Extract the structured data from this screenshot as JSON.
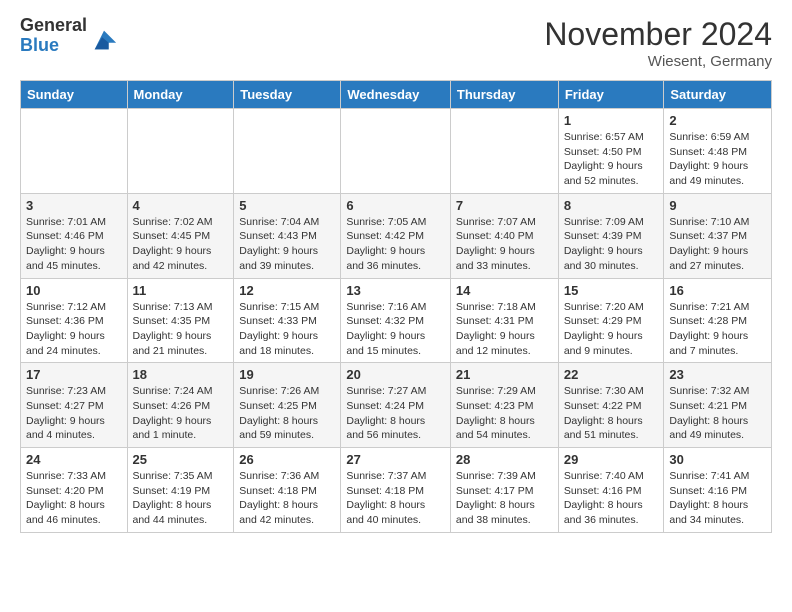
{
  "logo": {
    "general": "General",
    "blue": "Blue"
  },
  "title": "November 2024",
  "location": "Wiesent, Germany",
  "days_of_week": [
    "Sunday",
    "Monday",
    "Tuesday",
    "Wednesday",
    "Thursday",
    "Friday",
    "Saturday"
  ],
  "weeks": [
    [
      {
        "day": "",
        "info": ""
      },
      {
        "day": "",
        "info": ""
      },
      {
        "day": "",
        "info": ""
      },
      {
        "day": "",
        "info": ""
      },
      {
        "day": "",
        "info": ""
      },
      {
        "day": "1",
        "info": "Sunrise: 6:57 AM\nSunset: 4:50 PM\nDaylight: 9 hours and 52 minutes."
      },
      {
        "day": "2",
        "info": "Sunrise: 6:59 AM\nSunset: 4:48 PM\nDaylight: 9 hours and 49 minutes."
      }
    ],
    [
      {
        "day": "3",
        "info": "Sunrise: 7:01 AM\nSunset: 4:46 PM\nDaylight: 9 hours and 45 minutes."
      },
      {
        "day": "4",
        "info": "Sunrise: 7:02 AM\nSunset: 4:45 PM\nDaylight: 9 hours and 42 minutes."
      },
      {
        "day": "5",
        "info": "Sunrise: 7:04 AM\nSunset: 4:43 PM\nDaylight: 9 hours and 39 minutes."
      },
      {
        "day": "6",
        "info": "Sunrise: 7:05 AM\nSunset: 4:42 PM\nDaylight: 9 hours and 36 minutes."
      },
      {
        "day": "7",
        "info": "Sunrise: 7:07 AM\nSunset: 4:40 PM\nDaylight: 9 hours and 33 minutes."
      },
      {
        "day": "8",
        "info": "Sunrise: 7:09 AM\nSunset: 4:39 PM\nDaylight: 9 hours and 30 minutes."
      },
      {
        "day": "9",
        "info": "Sunrise: 7:10 AM\nSunset: 4:37 PM\nDaylight: 9 hours and 27 minutes."
      }
    ],
    [
      {
        "day": "10",
        "info": "Sunrise: 7:12 AM\nSunset: 4:36 PM\nDaylight: 9 hours and 24 minutes."
      },
      {
        "day": "11",
        "info": "Sunrise: 7:13 AM\nSunset: 4:35 PM\nDaylight: 9 hours and 21 minutes."
      },
      {
        "day": "12",
        "info": "Sunrise: 7:15 AM\nSunset: 4:33 PM\nDaylight: 9 hours and 18 minutes."
      },
      {
        "day": "13",
        "info": "Sunrise: 7:16 AM\nSunset: 4:32 PM\nDaylight: 9 hours and 15 minutes."
      },
      {
        "day": "14",
        "info": "Sunrise: 7:18 AM\nSunset: 4:31 PM\nDaylight: 9 hours and 12 minutes."
      },
      {
        "day": "15",
        "info": "Sunrise: 7:20 AM\nSunset: 4:29 PM\nDaylight: 9 hours and 9 minutes."
      },
      {
        "day": "16",
        "info": "Sunrise: 7:21 AM\nSunset: 4:28 PM\nDaylight: 9 hours and 7 minutes."
      }
    ],
    [
      {
        "day": "17",
        "info": "Sunrise: 7:23 AM\nSunset: 4:27 PM\nDaylight: 9 hours and 4 minutes."
      },
      {
        "day": "18",
        "info": "Sunrise: 7:24 AM\nSunset: 4:26 PM\nDaylight: 9 hours and 1 minute."
      },
      {
        "day": "19",
        "info": "Sunrise: 7:26 AM\nSunset: 4:25 PM\nDaylight: 8 hours and 59 minutes."
      },
      {
        "day": "20",
        "info": "Sunrise: 7:27 AM\nSunset: 4:24 PM\nDaylight: 8 hours and 56 minutes."
      },
      {
        "day": "21",
        "info": "Sunrise: 7:29 AM\nSunset: 4:23 PM\nDaylight: 8 hours and 54 minutes."
      },
      {
        "day": "22",
        "info": "Sunrise: 7:30 AM\nSunset: 4:22 PM\nDaylight: 8 hours and 51 minutes."
      },
      {
        "day": "23",
        "info": "Sunrise: 7:32 AM\nSunset: 4:21 PM\nDaylight: 8 hours and 49 minutes."
      }
    ],
    [
      {
        "day": "24",
        "info": "Sunrise: 7:33 AM\nSunset: 4:20 PM\nDaylight: 8 hours and 46 minutes."
      },
      {
        "day": "25",
        "info": "Sunrise: 7:35 AM\nSunset: 4:19 PM\nDaylight: 8 hours and 44 minutes."
      },
      {
        "day": "26",
        "info": "Sunrise: 7:36 AM\nSunset: 4:18 PM\nDaylight: 8 hours and 42 minutes."
      },
      {
        "day": "27",
        "info": "Sunrise: 7:37 AM\nSunset: 4:18 PM\nDaylight: 8 hours and 40 minutes."
      },
      {
        "day": "28",
        "info": "Sunrise: 7:39 AM\nSunset: 4:17 PM\nDaylight: 8 hours and 38 minutes."
      },
      {
        "day": "29",
        "info": "Sunrise: 7:40 AM\nSunset: 4:16 PM\nDaylight: 8 hours and 36 minutes."
      },
      {
        "day": "30",
        "info": "Sunrise: 7:41 AM\nSunset: 4:16 PM\nDaylight: 8 hours and 34 minutes."
      }
    ]
  ]
}
